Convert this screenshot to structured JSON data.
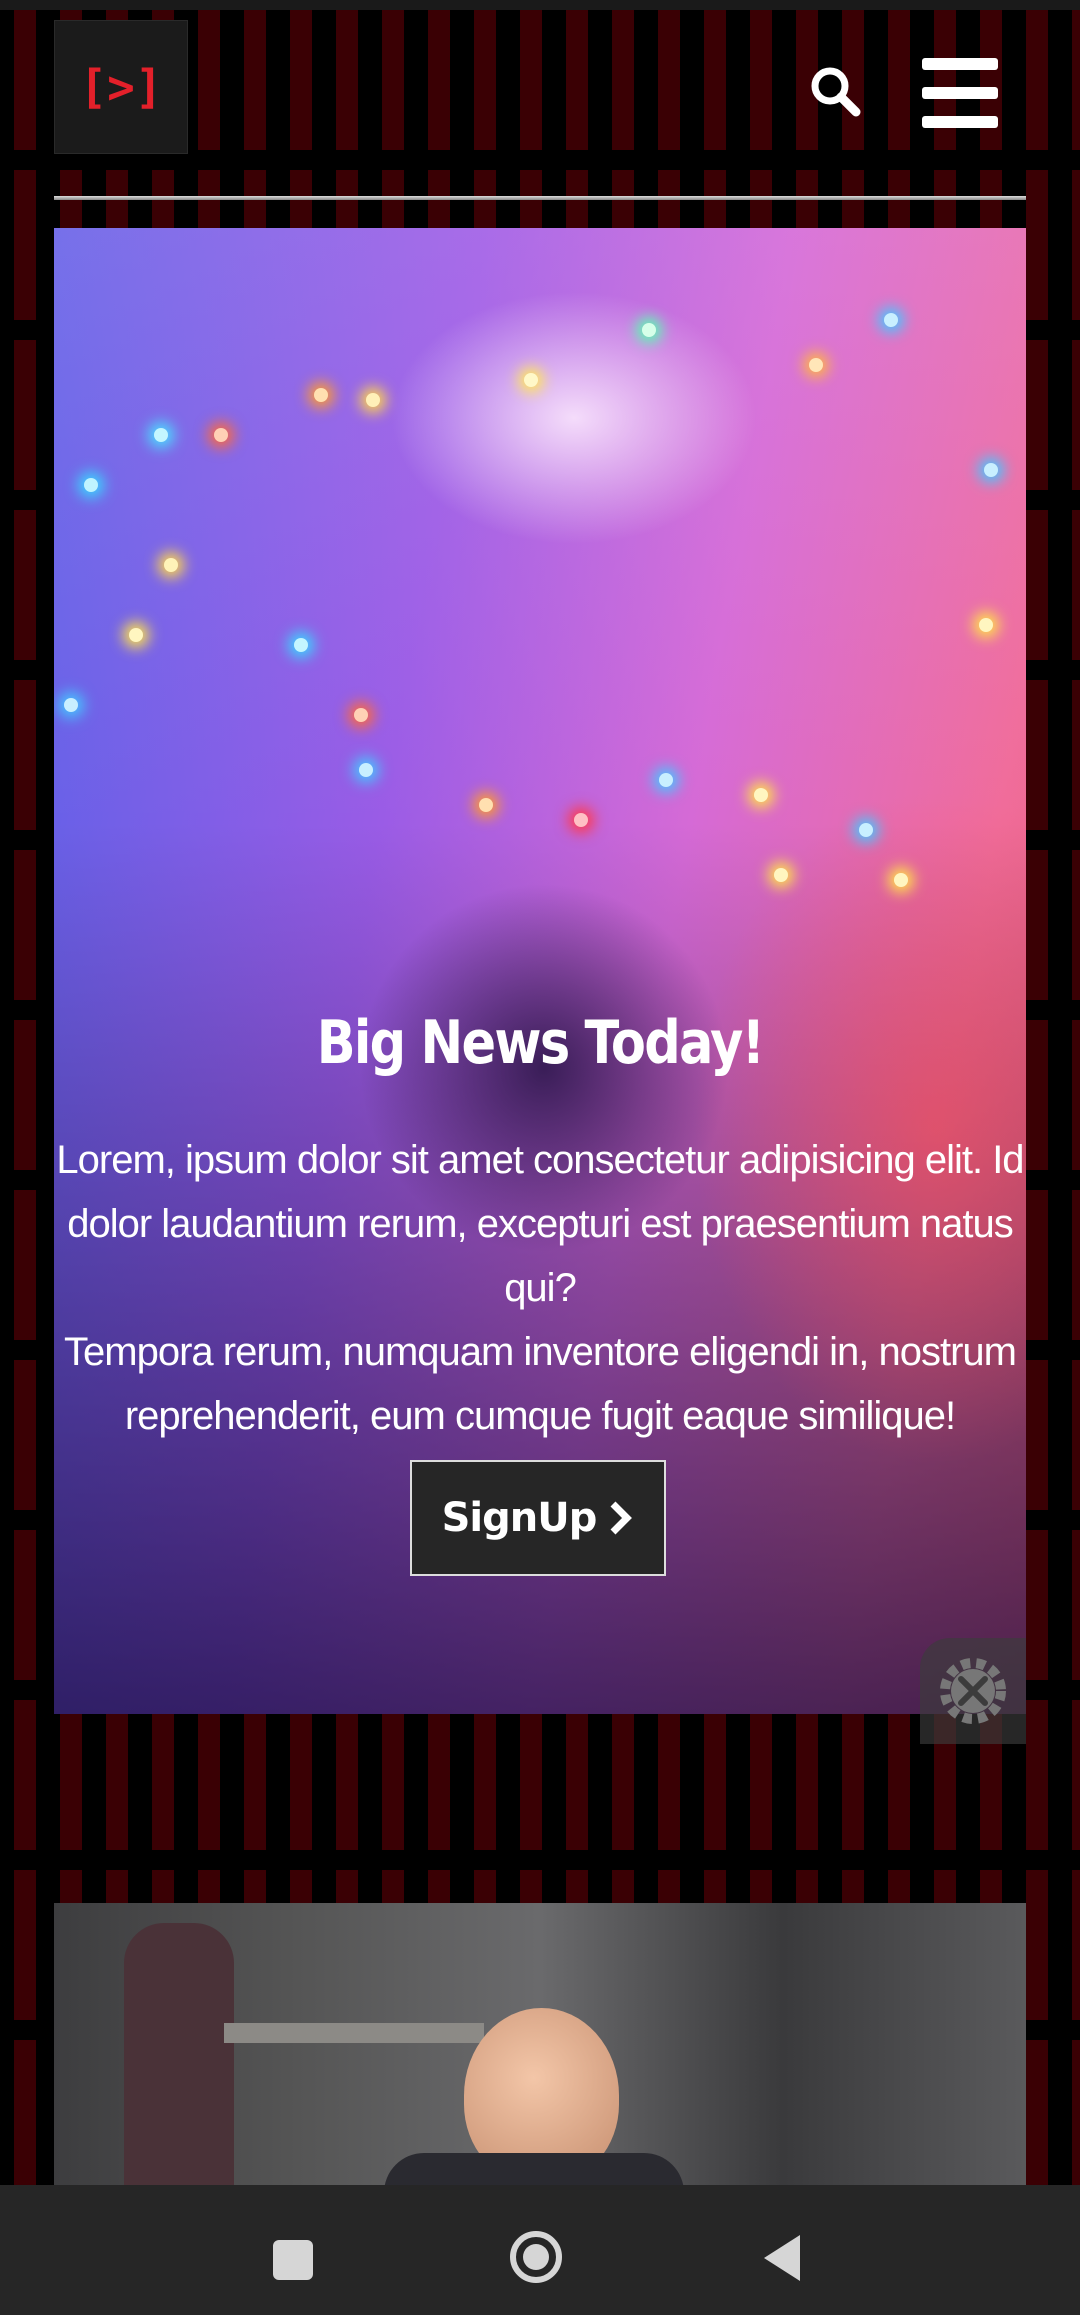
{
  "header": {
    "logo_text": "[>]",
    "logo_color": "#e3202a",
    "search_icon": "search-icon",
    "menu_icon": "hamburger-menu-icon"
  },
  "hero": {
    "title": "Big News Today!",
    "body_lines": [
      "Lorem, ipsum dolor sit amet consectetur adipisicing elit. Id",
      "dolor laudantium rerum, excepturi est praesentium natus qui?",
      "Tempora rerum, numquam inventore eligendi in, nostrum",
      "reprehenderit, eum cumque fugit eaque similique!"
    ],
    "signup_label": "SignUp",
    "signup_chevron": "›",
    "settings_icon": "settings-tools-icon"
  },
  "nav": {
    "recents_icon": "square-icon",
    "home_icon": "circle-icon",
    "back_icon": "triangle-back-icon"
  },
  "colors": {
    "background": "#000000",
    "pattern": "#3a0004",
    "button_bg": "#262626",
    "nav_bar": "#262626"
  }
}
